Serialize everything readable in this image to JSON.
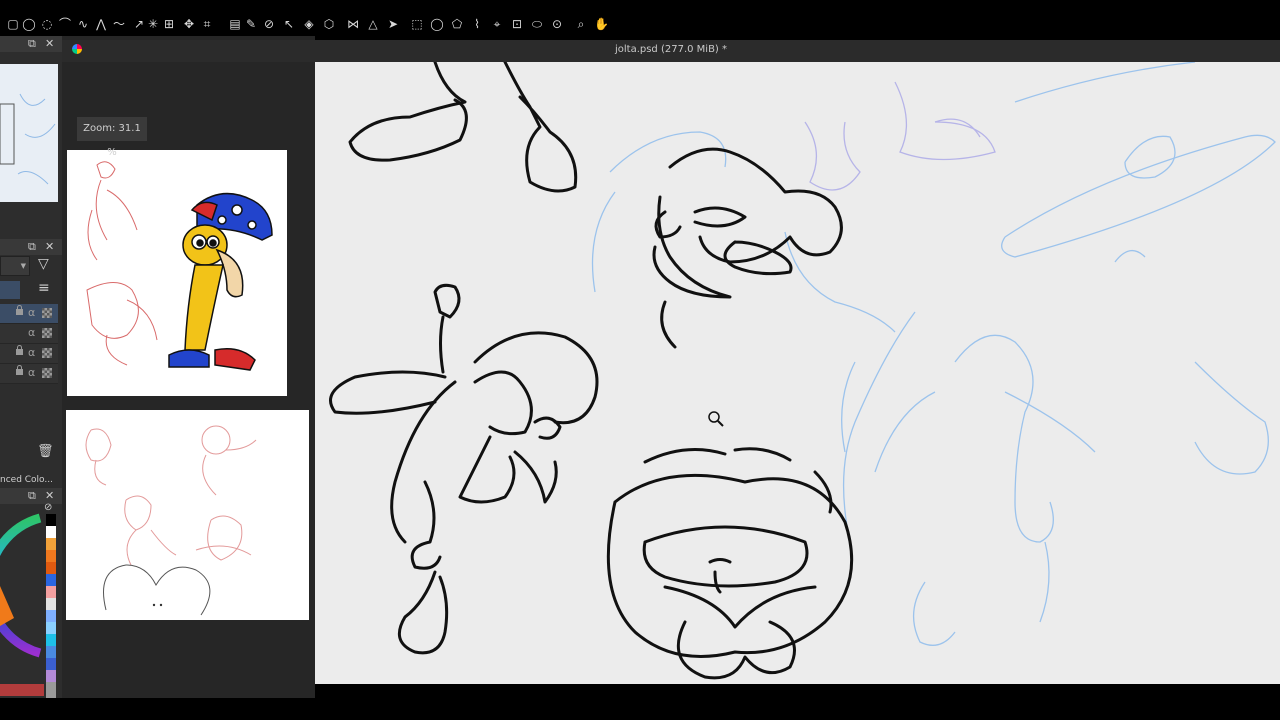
{
  "document": {
    "title": "jolta.psd (277.0 MiB) *"
  },
  "canvas": {
    "zoom_label": "Zoom: 31.1 %"
  },
  "docker": {
    "color_panel_title": "nced Colo...",
    "close_glyph": "✕",
    "float_glyph": "⧉",
    "filter_glyph": "▽",
    "menu_glyph": "≡",
    "trash_glyph": "🗑",
    "alpha_glyph": "α"
  },
  "colors": {
    "canvas_bg": "#ececec",
    "panel_bg": "#2d2d2d",
    "selected_layer": "#3b4d66",
    "sketch_blue": "#8fb9e6",
    "sketch_red": "#d96b6b",
    "ink": "#111111",
    "character_yellow": "#f2c318",
    "hat_blue": "#2244cc",
    "hat_red": "#d62b2b"
  }
}
